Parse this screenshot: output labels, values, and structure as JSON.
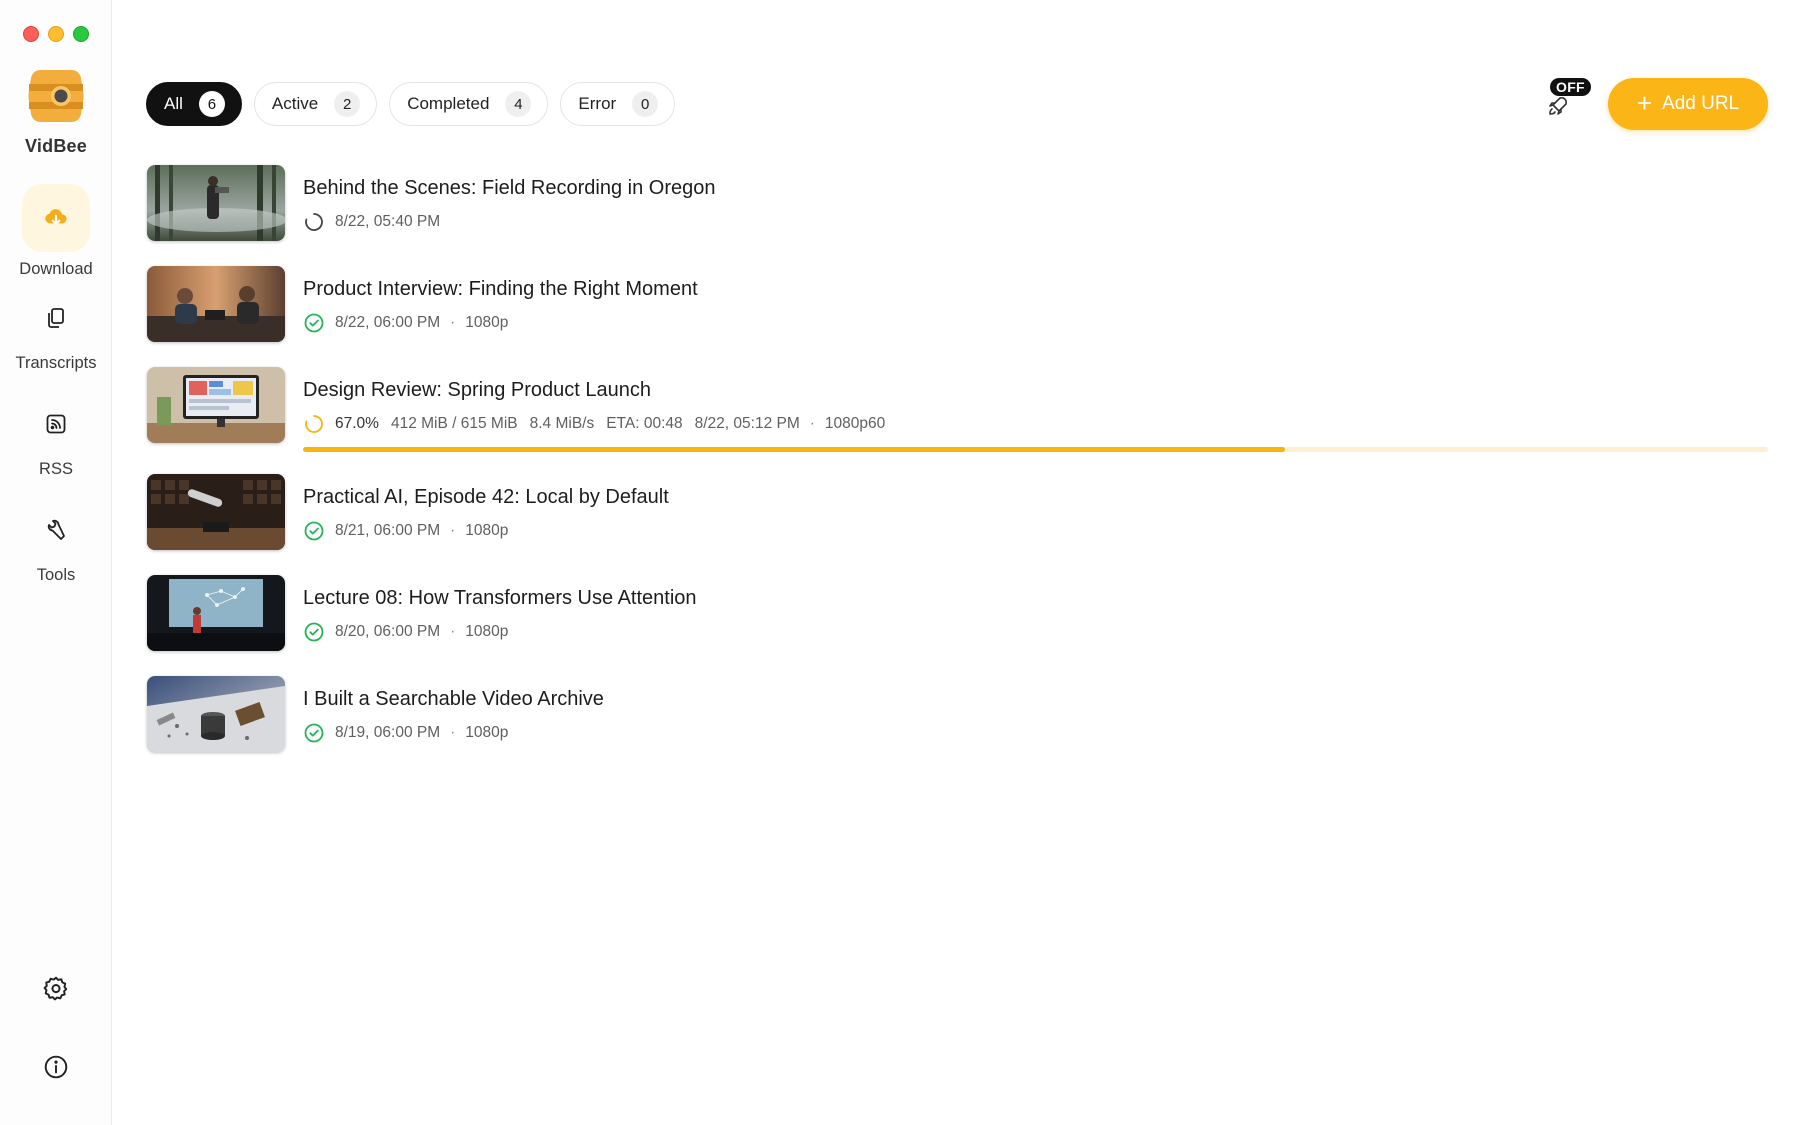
{
  "app": {
    "name": "VidBee",
    "accent_color": "#fbb516"
  },
  "sidebar": {
    "items": [
      {
        "label": "Download",
        "icon": "cloud-download-icon",
        "active": true
      },
      {
        "label": "Transcripts",
        "icon": "copy-documents-icon",
        "active": false
      },
      {
        "label": "RSS",
        "icon": "rss-icon",
        "active": false
      },
      {
        "label": "Tools",
        "icon": "wrench-icon",
        "active": false
      }
    ],
    "bottom": [
      {
        "icon": "settings-gear-icon"
      },
      {
        "icon": "info-icon"
      }
    ]
  },
  "filters": [
    {
      "label": "All",
      "count": "6",
      "selected": true
    },
    {
      "label": "Active",
      "count": "2",
      "selected": false
    },
    {
      "label": "Completed",
      "count": "4",
      "selected": false
    },
    {
      "label": "Error",
      "count": "0",
      "selected": false
    }
  ],
  "toolbar": {
    "auto_download_state": "OFF",
    "add_url_label": "Add URL"
  },
  "downloads": [
    {
      "title": "Behind the Scenes: Field Recording in Oregon",
      "status": "pending",
      "date": "8/22, 05:40 PM",
      "resolution": ""
    },
    {
      "title": "Product Interview: Finding the Right Moment",
      "status": "completed",
      "date": "8/22, 06:00 PM",
      "resolution": "1080p"
    },
    {
      "title": "Design Review: Spring Product Launch",
      "status": "downloading",
      "progress_text": "67.0%",
      "progress": 0.67,
      "size": "412 MiB / 615 MiB",
      "speed": "8.4 MiB/s",
      "eta": "ETA: 00:48",
      "date": "8/22, 05:12 PM",
      "resolution": "1080p60"
    },
    {
      "title": "Practical AI, Episode 42: Local by Default",
      "status": "completed",
      "date": "8/21, 06:00 PM",
      "resolution": "1080p"
    },
    {
      "title": "Lecture 08: How Transformers Use Attention",
      "status": "completed",
      "date": "8/20, 06:00 PM",
      "resolution": "1080p"
    },
    {
      "title": "I Built a Searchable Video Archive",
      "status": "completed",
      "date": "8/19, 06:00 PM",
      "resolution": "1080p"
    }
  ]
}
